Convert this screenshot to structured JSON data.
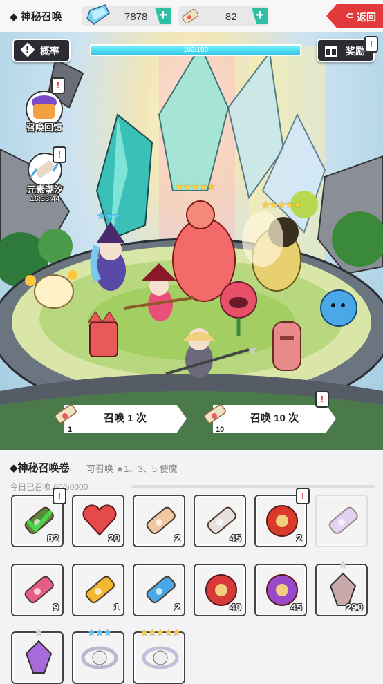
{
  "header": {
    "title": "◆ 神秘召唤",
    "gems": "7878",
    "scrolls": "82",
    "back_label": "返回"
  },
  "scene": {
    "rate_label": "概率",
    "reward_label": "奖励",
    "progress_text": "102/100",
    "progress_fraction": 1.0,
    "feedback_label": "召唤回馈",
    "tide_label": "元素潮汐",
    "tide_timer": "16:33:44",
    "stars_left": "★★★",
    "stars_center": "★★★★★",
    "stars_right": "★★★★★",
    "summon1_label": "召唤 1 次",
    "summon1_cost": "1",
    "summon10_label": "召唤 10 次",
    "summon10_cost": "10"
  },
  "panel": {
    "title": "◆神秘召唤卷",
    "subtitle": "可召唤 ★1、3、5 使魔",
    "today": "今日已召唤 60/50000",
    "items": [
      {
        "name": "green-check-scroll",
        "count": "82",
        "color": "#5a8a3a"
      },
      {
        "name": "red-heart",
        "count": "20",
        "color": "#e54a4a"
      },
      {
        "name": "pink-ribbon-scroll",
        "count": "2",
        "color": "#f2c6a0"
      },
      {
        "name": "pink-gem-scroll",
        "count": "45",
        "color": "#e8e0e0"
      },
      {
        "name": "red-gold-scroll",
        "count": "2",
        "color": "#d93a2a"
      },
      {
        "name": "lavender-scroll",
        "count": "",
        "color": "#d8b8f0"
      },
      {
        "name": "pink-striped-scroll",
        "count": "9",
        "color": "#e85c8a"
      },
      {
        "name": "yellow-striped-scroll",
        "count": "1",
        "color": "#f2b830"
      },
      {
        "name": "blue-striped-scroll",
        "count": "2",
        "color": "#4aa8e8"
      },
      {
        "name": "red-round-scroll",
        "count": "40",
        "color": "#d83a3a"
      },
      {
        "name": "purple-round-scroll",
        "count": "45",
        "color": "#9a4ac8"
      },
      {
        "name": "crystal-shard",
        "count": "290",
        "color": "#c8a8a8"
      },
      {
        "name": "purple-crystal",
        "count": "",
        "color": "#a86ad8"
      },
      {
        "name": "silver-ring-3star",
        "count": "",
        "color": "#b8b8d0"
      },
      {
        "name": "silver-ring-5star",
        "count": "",
        "color": "#c0c0d8"
      }
    ]
  }
}
